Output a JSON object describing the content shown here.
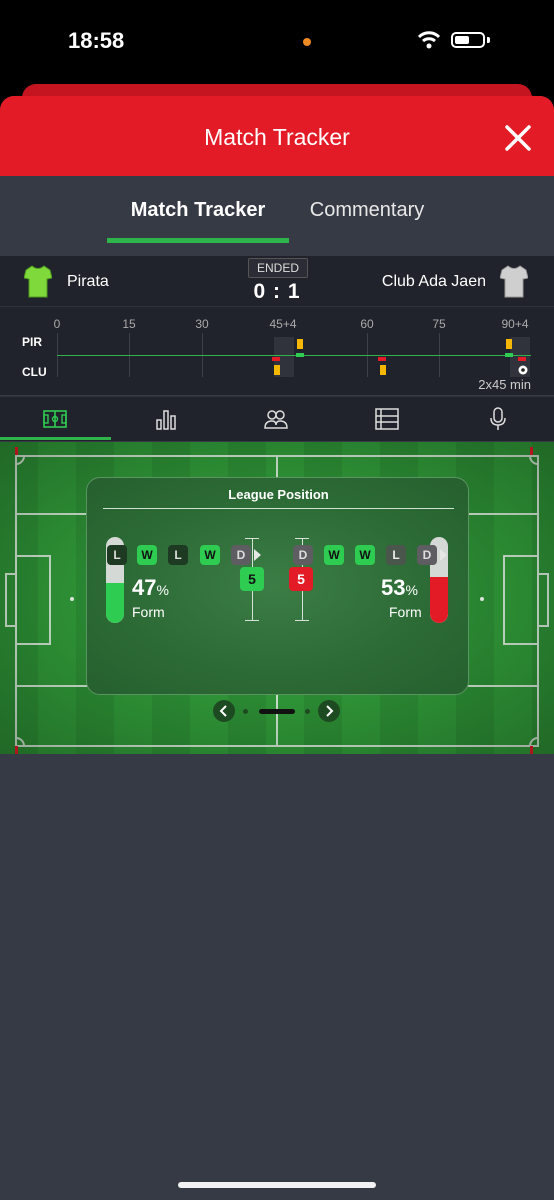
{
  "status": {
    "time": "18:58"
  },
  "header": {
    "title": "Match Tracker"
  },
  "tabs": [
    {
      "label": "Match Tracker"
    },
    {
      "label": "Commentary"
    }
  ],
  "match": {
    "home_team": "Pirata",
    "away_team": "Club Ada Jaen",
    "status": "ENDED",
    "score": "0 : 1"
  },
  "timeline": {
    "ticks": [
      "0",
      "15",
      "30",
      "45+4",
      "60",
      "75",
      "90+4"
    ],
    "rows": [
      "PIR",
      "CLU"
    ],
    "duration": "2x45 min"
  },
  "stat_icons": [
    "pitch-icon",
    "bar-chart-icon",
    "lineups-icon",
    "table-icon",
    "microphone-icon"
  ],
  "league_position": {
    "title": "League Position",
    "home": {
      "form_pct": "47",
      "pct_sign": "%",
      "form_label": "Form",
      "position": "5",
      "last5": [
        "L",
        "W",
        "L",
        "W",
        "D"
      ],
      "color": "#2fcc52"
    },
    "away": {
      "form_pct": "53",
      "pct_sign": "%",
      "form_label": "Form",
      "position": "5",
      "last5": [
        "D",
        "W",
        "W",
        "L",
        "D"
      ],
      "color": "#e31b26"
    }
  },
  "colors": {
    "accent_red": "#e31b26",
    "accent_green": "#2fb34b",
    "bg": "#363a45"
  }
}
